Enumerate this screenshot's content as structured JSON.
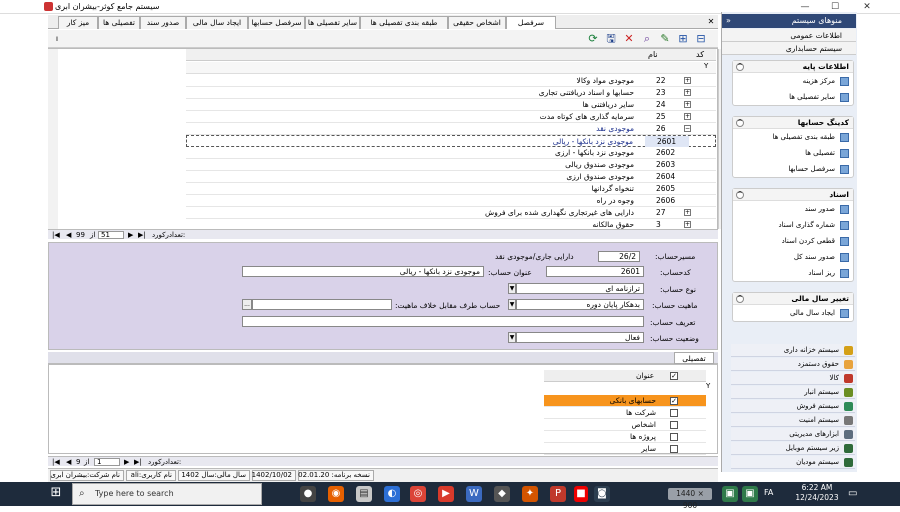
{
  "window": {
    "title": "سیستم جامع کوثر-بیشران ابری"
  },
  "tabs": [
    "سرفصل حسابها",
    "اشخاص حقیقی",
    "طبقه بندی تفصیلی ها",
    "سایر تفصیلی ها",
    "سرفصل حسابها",
    "ایجاد سال مالی",
    "صدور سند",
    "تفصیلی ها",
    "میز کار"
  ],
  "grid": {
    "col_code": "کد",
    "col_name": "نام",
    "rows": [
      {
        "code": "22",
        "name": "موجودی مواد وکالا",
        "exp": "+"
      },
      {
        "code": "23",
        "name": "حسابها و اسناد دریافتنی تجاری",
        "exp": "+"
      },
      {
        "code": "24",
        "name": "سایر دریافتنی ها",
        "exp": "+"
      },
      {
        "code": "25",
        "name": "سرمایه گذاری های کوتاه مدت",
        "exp": "+"
      },
      {
        "code": "26",
        "name": "موجودی نقد",
        "exp": "−"
      },
      {
        "code": "2601",
        "name": "موجودی نزد بانکها - ریالی",
        "exp": ""
      },
      {
        "code": "2602",
        "name": "موجودی نزد بانکها - ارزی",
        "exp": ""
      },
      {
        "code": "2603",
        "name": "موجودی صندوق ریالی",
        "exp": ""
      },
      {
        "code": "2604",
        "name": "موجودی صندوق ارزی",
        "exp": ""
      },
      {
        "code": "2605",
        "name": "تنخواه گردانها",
        "exp": ""
      },
      {
        "code": "2606",
        "name": "وجوه در راه",
        "exp": ""
      },
      {
        "code": "27",
        "name": "دارایی های غیرتجاری نگهداری شده برای فروش",
        "exp": "+"
      },
      {
        "code": "3",
        "name": "حقوق مالکانه",
        "exp": "+"
      }
    ],
    "pager": {
      "current": "51",
      "of_label": "از",
      "total": "99",
      "count_label": "تعدادرکورد:"
    }
  },
  "form": {
    "path_label": "مسیرحساب:",
    "path_code": "26/2",
    "path_text": "دارایی جاری/موجودی نقد",
    "code_label": "کدحساب:",
    "code_value": "2601",
    "title_label": "عنوان حساب:",
    "title_value": "موجودی نزد بانکها - ریالی",
    "type_label": "نوع حساب:",
    "type_value": "ترازنامه ای",
    "nature_label": "ماهیت حساب:",
    "nature_value": "بدهکار پایان دوره",
    "opposite_label": "حساب طرف مقابل خلاف ماهیت:",
    "opposite_btn": "...",
    "define_label": "تعریف حساب:",
    "status_label": "وضعیت حساب:",
    "status_value": "فعال"
  },
  "attachments": {
    "tab_label": "تفصیلی",
    "col_title": "عنوان",
    "items": [
      {
        "label": "حسابهای بانکی",
        "checked": true
      },
      {
        "label": "شرکت ها",
        "checked": false
      },
      {
        "label": "اشخاص",
        "checked": false
      },
      {
        "label": "پروژه ها",
        "checked": false
      },
      {
        "label": "سایر",
        "checked": false
      }
    ],
    "pager": {
      "current": "1",
      "of_label": "از",
      "total": "9",
      "count_label": "تعدادرکورد:"
    }
  },
  "statusbar": {
    "company": "نام شرکت:بیشران ابری",
    "user": "نام کاربری:ali",
    "fiscal_year": "سال مالی:سال 1402",
    "date": "1402/10/02",
    "version": "نسخه برنامه: 02.01.20"
  },
  "nav": {
    "header": "منوهای سیستم",
    "top_items": [
      "اطلاعات عمومی",
      "سیستم حسابداری"
    ],
    "sections": [
      {
        "title": "اطلاعات پایه",
        "items": [
          "مرکز هزینه",
          "سایر تفصیلی ها"
        ]
      },
      {
        "title": "کدینگ حسابها",
        "items": [
          "طبقه بندی تفصیلی ها",
          "تفصیلی ها",
          "سرفصل حسابها"
        ]
      },
      {
        "title": "اسناد",
        "items": [
          "صدور سند",
          "شماره گذاری اسناد",
          "قطعی کردن اسناد",
          "صدور سند کل",
          "ریز اسناد"
        ]
      },
      {
        "title": "تغییر سال مالی",
        "items": [
          "ایجاد سال مالی"
        ]
      }
    ],
    "bottom_items": [
      "سیستم خزانه داری",
      "حقوق دستمزد",
      "کالا",
      "سیستم انبار",
      "سیستم فروش",
      "سیستم امنیت",
      "ابزارهای مدیریتی",
      "زیر سیستم موبایل",
      "سیستم مودیان"
    ]
  },
  "taskbar": {
    "search_placeholder": "Type here to search",
    "resolution": "1440 × 900",
    "time": "6:22 AM",
    "date": "12/24/2023",
    "lang": "FA"
  },
  "colors": {
    "nav_header": "#2f4877",
    "form_bg": "#d9d2e9",
    "highlight": "#f7941d",
    "taskbar": "#1e2b3c"
  }
}
